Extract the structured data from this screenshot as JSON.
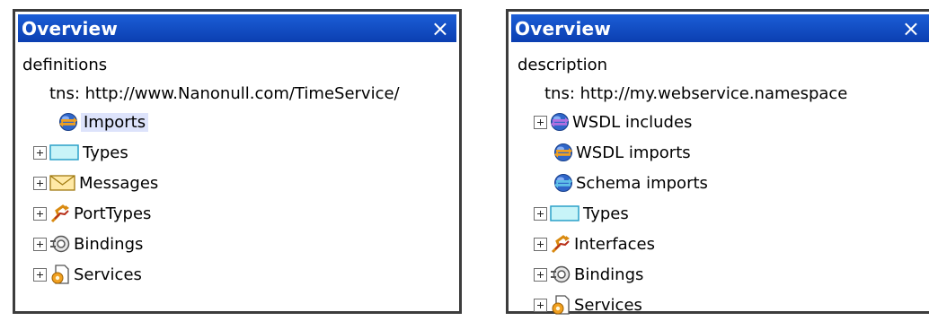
{
  "left": {
    "title": "Overview",
    "close_glyph": "×",
    "root_label": "definitions",
    "namespace": "tns:  http://www.Nanonull.com/TimeService/",
    "items": [
      {
        "label": "Imports",
        "icon": "import-sphere-icon",
        "expandable": false,
        "selected": true
      },
      {
        "label": "Types",
        "icon": "types-box-icon",
        "expandable": true
      },
      {
        "label": "Messages",
        "icon": "envelope-icon",
        "expandable": true
      },
      {
        "label": "PortTypes",
        "icon": "porttype-arrows-icon",
        "expandable": true
      },
      {
        "label": "Bindings",
        "icon": "binding-chain-icon",
        "expandable": true
      },
      {
        "label": "Services",
        "icon": "service-document-gear-icon",
        "expandable": true
      }
    ]
  },
  "right": {
    "title": "Overview",
    "close_glyph": "×",
    "root_label": "description",
    "namespace": "tns:  http://my.webservice.namespace",
    "items": [
      {
        "label": "WSDL includes",
        "icon": "include-sphere-icon",
        "expandable": true
      },
      {
        "label": "WSDL imports",
        "icon": "import-sphere-icon",
        "expandable": false
      },
      {
        "label": "Schema imports",
        "icon": "schema-sphere-icon",
        "expandable": false
      },
      {
        "label": "Types",
        "icon": "types-box-icon",
        "expandable": true
      },
      {
        "label": "Interfaces",
        "icon": "interface-arrows-icon",
        "expandable": true
      },
      {
        "label": "Bindings",
        "icon": "binding-chain-icon",
        "expandable": true
      },
      {
        "label": "Services",
        "icon": "service-document-gear-icon",
        "expandable": true
      }
    ]
  },
  "colors": {
    "titlebar": "#0b3fb1",
    "selection": "#dde3fb",
    "sphere_blue": "#2f66c9",
    "arrow_orange": "#f0a020",
    "types_fill": "#c8f4f8"
  }
}
